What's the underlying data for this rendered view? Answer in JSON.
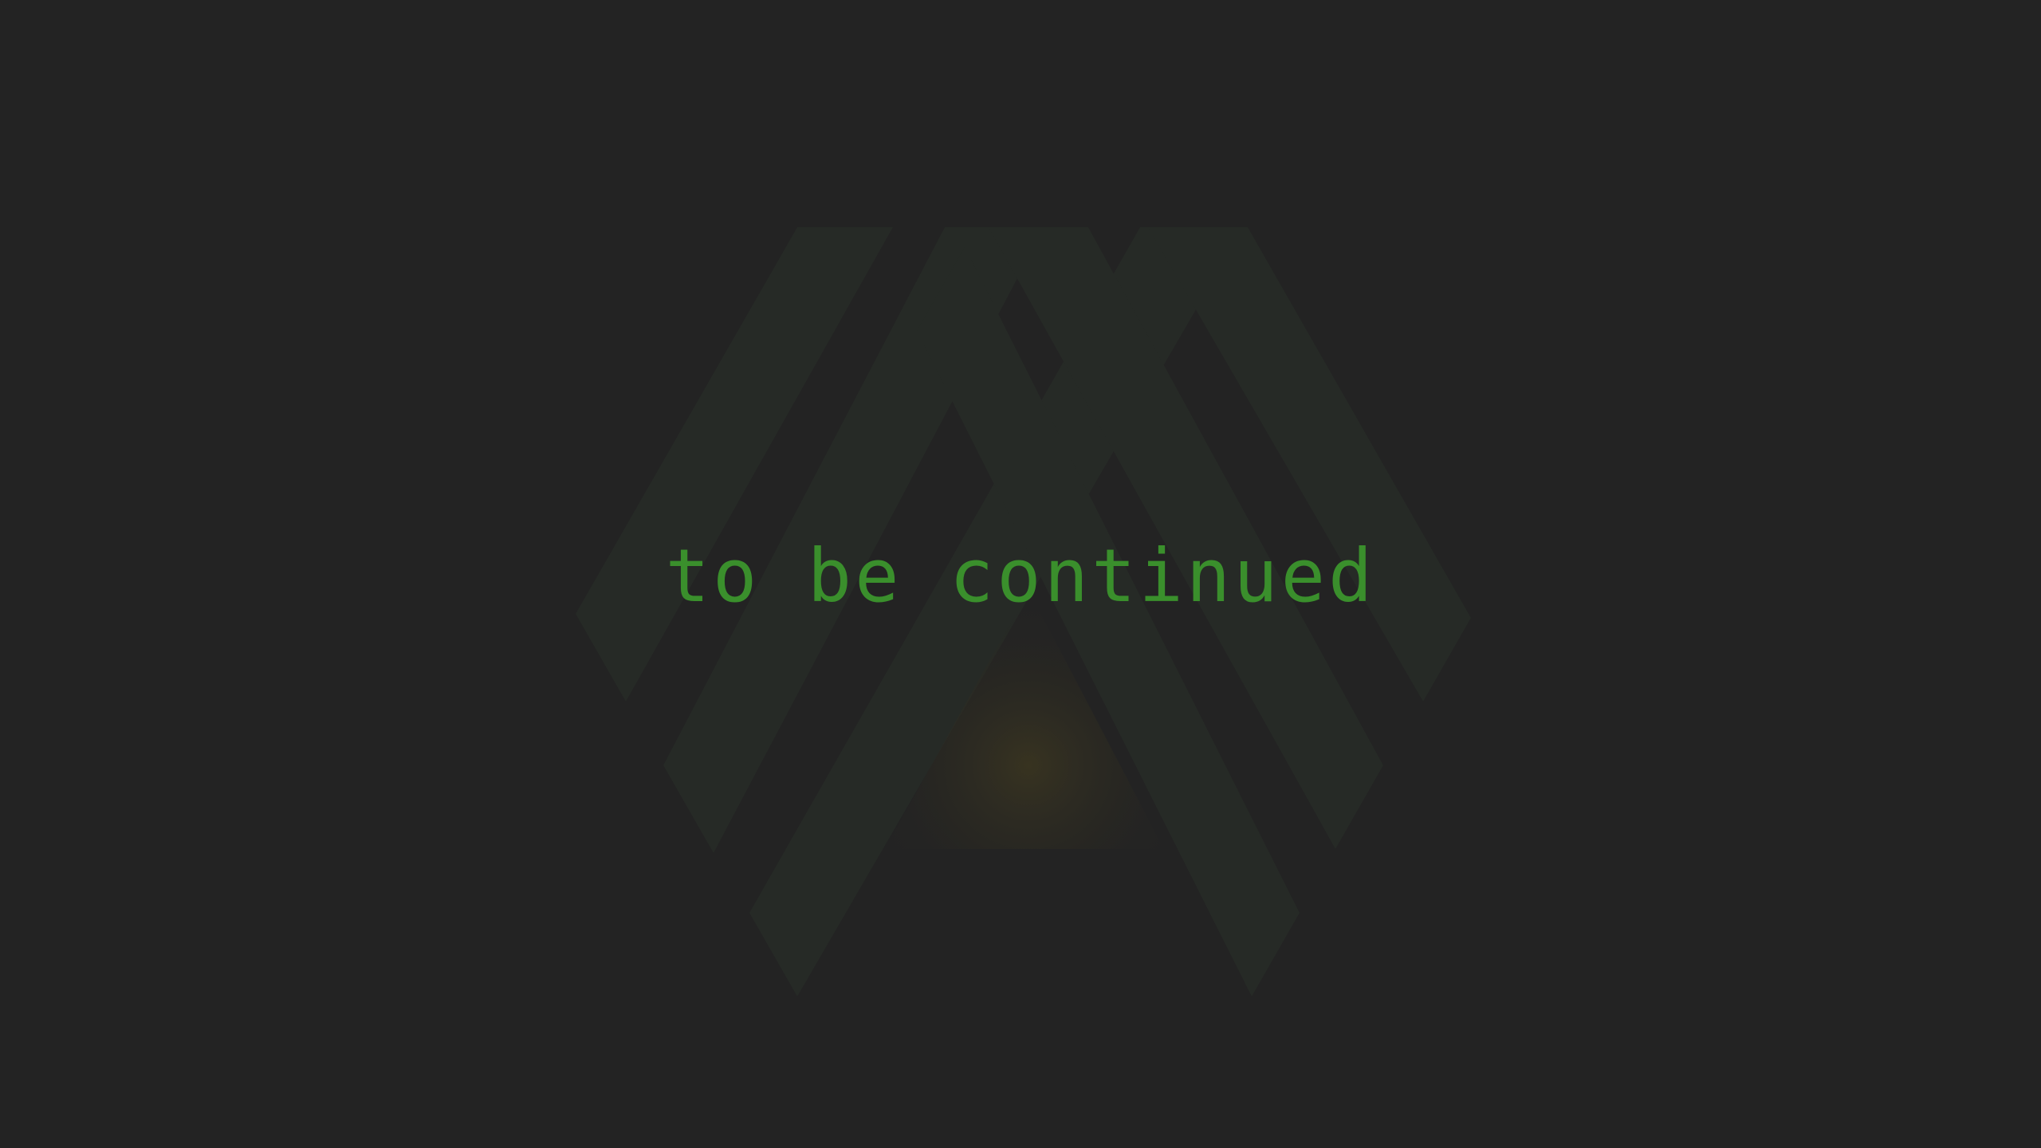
{
  "screen": {
    "message": "to be continued"
  },
  "emblem": {
    "icon": "triangular-chevron-logo-icon"
  },
  "colors": {
    "background": "#232323",
    "text": "#3a8f2c",
    "emblem_stripe": "#262a26",
    "glow": "#3a3520"
  }
}
